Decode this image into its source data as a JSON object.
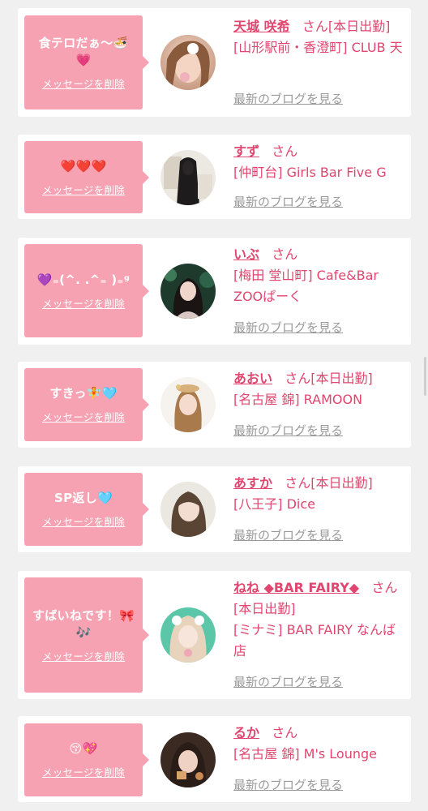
{
  "entries": [
    {
      "message": "食テロだぁ〜🍜💗",
      "delete_label": "メッセージを削除",
      "name": "天城 咲希",
      "suffix": "さん[本日出勤]",
      "shop": "[山形駅前・香澄町] CLUB 天",
      "blog_label": "最新のブログを見る"
    },
    {
      "message": "❤️❤️❤️",
      "delete_label": "メッセージを削除",
      "name": "すず",
      "suffix": "さん",
      "shop": "[仲町台] Girls Bar Five G",
      "blog_label": "最新のブログを見る"
    },
    {
      "message": "💜₌(^. .^₌ )₌ᵍ",
      "delete_label": "メッセージを削除",
      "name": "いぶ",
      "suffix": "さん",
      "shop": "[梅田 堂山町] Cafe&Bar ZOOぱーく",
      "blog_label": "最新のブログを見る"
    },
    {
      "message": "すきっ🧚🩵",
      "delete_label": "メッセージを削除",
      "name": "あおい",
      "suffix": "さん[本日出勤]",
      "shop": "[名古屋 錦] RAMOON",
      "blog_label": "最新のブログを見る"
    },
    {
      "message": "SP返し🩵",
      "delete_label": "メッセージを削除",
      "name": "あすか",
      "suffix": "さん[本日出勤]",
      "shop": "[八王子] Dice",
      "blog_label": "最新のブログを見る"
    },
    {
      "message": "すばいねです！🎀🎶",
      "delete_label": "メッセージを削除",
      "name": "ねね ◆BAR FAIRY◆",
      "suffix": "さん[本日出勤]",
      "shop": "[ミナミ] BAR FAIRY なんば店",
      "blog_label": "最新のブログを見る"
    },
    {
      "message": "😚💖",
      "delete_label": "メッセージを削除",
      "name": "るか",
      "suffix": "さん",
      "shop": "[名古屋 錦] M's Lounge",
      "blog_label": "最新のブログを見る"
    }
  ]
}
